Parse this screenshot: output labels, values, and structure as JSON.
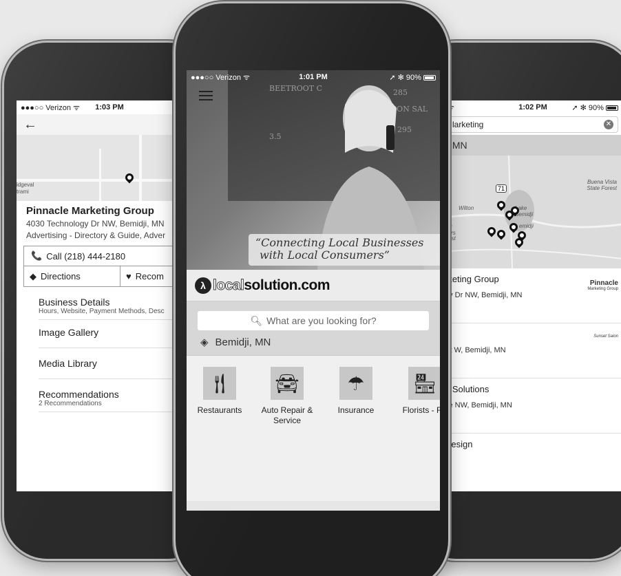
{
  "left": {
    "status": {
      "carrier": "●●●○○ Verizon ᯤ",
      "time": "1:03 PM"
    },
    "back_icon": "←",
    "map": {
      "label_top": "idgeval",
      "label_bottom": "trami"
    },
    "business": {
      "name": "Pinnacle Marketing Group",
      "address": "4030 Technology Dr NW, Bemidji, MN",
      "category": "Advertising - Directory & Guide, Adver"
    },
    "call_label": "Call (218) 444-2180",
    "directions_label": "Directions",
    "recommend_label": "Recom",
    "menu": [
      {
        "title": "Business Details",
        "sub": "Hours, Website, Payment Methods, Desc"
      },
      {
        "title": "Image Gallery",
        "sub": ""
      },
      {
        "title": "Media Library",
        "sub": ""
      },
      {
        "title": "Recommendations",
        "sub": "2 Recommendations"
      }
    ]
  },
  "center": {
    "status": {
      "carrier": "●●●○○ Verizon ᯤ",
      "time": "1:01 PM",
      "right": "➚ ✻ 90%"
    },
    "quote_line1": "“Connecting Local Businesses",
    "quote_line2": "with Local Consumers”",
    "logo_mark": "λ",
    "logo_light": "local",
    "logo_dark": "solution.com",
    "search_placeholder": "What are you looking for?",
    "location": "Bemidji, MN",
    "categories": [
      {
        "icon": "restaurant-icon",
        "label": "Restaurants"
      },
      {
        "icon": "car-icon",
        "label": "Auto Repair & Service"
      },
      {
        "icon": "umbrella-icon",
        "label": "Insurance"
      },
      {
        "icon": "florist-icon",
        "label": "Florists - Re"
      }
    ]
  },
  "right": {
    "status": {
      "carrier": "ᯤ",
      "time": "1:02 PM",
      "right": "➚ ✻ 90%"
    },
    "search_value": "larketing",
    "location": "i, MN",
    "map_labels": {
      "wilton": "Wilton",
      "lake": "Lake Bemidji",
      "bemidji": "emidji",
      "forest": "Buena Vista State Forest",
      "hwy": "71",
      "ippi": "ippi",
      "aters": "aters",
      "orest": "orest"
    },
    "results": [
      {
        "title": "rketing Group",
        "address": "gy Dr NW, Bemidji, MN",
        "brand": "Pinnacle",
        "brand_sub": "Marketing Group"
      },
      {
        "title": "h",
        "address": "St W, Bemidji, MN",
        "brand": "Sunset Salon",
        "brand_sub": ""
      },
      {
        "title": "g Solutions",
        "address": "ve NW, Bemidji, MN",
        "brand": "",
        "brand_sub": ""
      },
      {
        "title": "Design",
        "address": "",
        "brand": "",
        "brand_sub": ""
      }
    ]
  }
}
